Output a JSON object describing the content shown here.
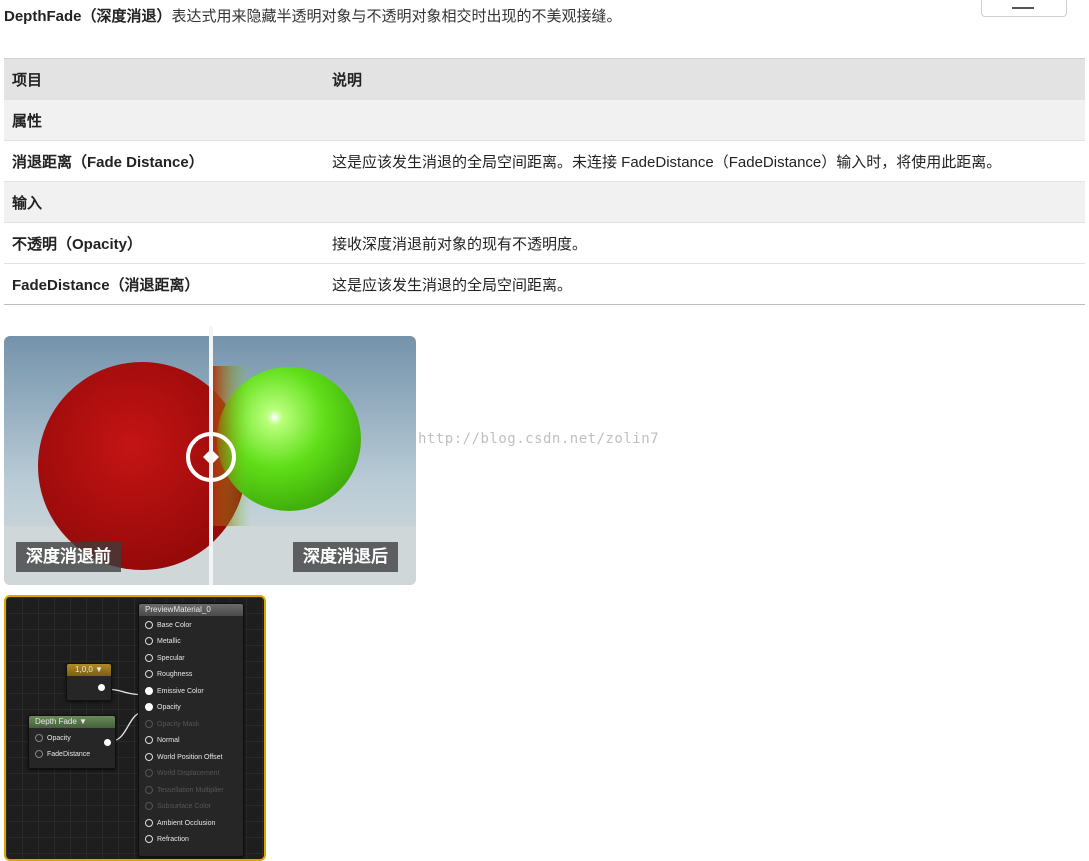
{
  "intro": {
    "lead": "DepthFade（深度消退）",
    "text": "表达式用来隐藏半透明对象与不透明对象相交时出现的不美观接缝。"
  },
  "table": {
    "headers": [
      "项目",
      "说明"
    ],
    "sections": [
      {
        "title": "属性",
        "rows": [
          {
            "name": "消退距离（Fade Distance）",
            "desc": "这是应该发生消退的全局空间距离。未连接 FadeDistance（FadeDistance）输入时，将使用此距离。"
          }
        ]
      },
      {
        "title": "输入",
        "rows": [
          {
            "name": "不透明（Opacity）",
            "desc": "接收深度消退前对象的现有不透明度。"
          },
          {
            "name": "FadeDistance（消退距离）",
            "desc": "这是应该发生消退的全局空间距离。"
          }
        ]
      }
    ]
  },
  "comparison": {
    "before_label": "深度消退前",
    "after_label": "深度消退后",
    "colors": {
      "before_sphere": "#b30d0d",
      "after_sphere": "#66e21e",
      "sky": "#b9cbd6"
    }
  },
  "watermark": "http://blog.csdn.net/zolin7",
  "graph": {
    "material_node": {
      "title": "PreviewMaterial_0",
      "pins": [
        {
          "label": "Base Color",
          "active": true,
          "connected": false
        },
        {
          "label": "Metallic",
          "active": true,
          "connected": false
        },
        {
          "label": "Specular",
          "active": true,
          "connected": false
        },
        {
          "label": "Roughness",
          "active": true,
          "connected": false
        },
        {
          "label": "Emissive Color",
          "active": true,
          "connected": true
        },
        {
          "label": "Opacity",
          "active": true,
          "connected": true
        },
        {
          "label": "Opacity Mask",
          "active": false,
          "connected": false
        },
        {
          "label": "Normal",
          "active": true,
          "connected": false
        },
        {
          "label": "World Position Offset",
          "active": true,
          "connected": false
        },
        {
          "label": "World Displacement",
          "active": false,
          "connected": false
        },
        {
          "label": "Tessellation Multiplier",
          "active": false,
          "connected": false
        },
        {
          "label": "Subsurface Color",
          "active": false,
          "connected": false
        },
        {
          "label": "Ambient Occlusion",
          "active": true,
          "connected": false
        },
        {
          "label": "Refraction",
          "active": true,
          "connected": false
        }
      ]
    },
    "constant_node": {
      "title": "1,0,0"
    },
    "depthfade_node": {
      "title": "Depth Fade",
      "inputs": [
        "Opacity",
        "FadeDistance"
      ]
    }
  }
}
